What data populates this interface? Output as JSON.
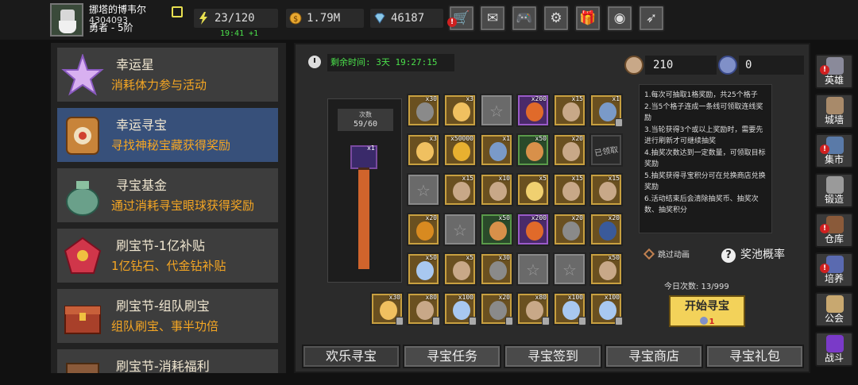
{
  "player": {
    "name": "挪塔的博韦尔",
    "id": "4304093",
    "rank": "勇者 - 5阶"
  },
  "resources": {
    "stamina": "23/120",
    "stamina_timer": "19:41 +1",
    "gold": "1.79M",
    "gems": "46187"
  },
  "top_buttons": [
    {
      "name": "shop",
      "icon": "cart-icon",
      "badge": "!"
    },
    {
      "name": "mail",
      "icon": "mail-icon"
    },
    {
      "name": "gamepad",
      "icon": "gamepad-icon"
    },
    {
      "name": "settings",
      "icon": "gear-icon"
    },
    {
      "name": "gift",
      "icon": "gift-icon"
    },
    {
      "name": "palette",
      "icon": "palette-icon"
    },
    {
      "name": "feather",
      "icon": "feather-icon"
    }
  ],
  "events": [
    {
      "title": "幸运星",
      "desc": "消耗体力参与活动",
      "icon_color": "#c89ae0"
    },
    {
      "title": "幸运寻宝",
      "desc": "寻找神秘宝藏获得奖励",
      "icon_color": "#c8843a"
    },
    {
      "title": "寻宝基金",
      "desc": "通过消耗寻宝眼球获得奖励",
      "icon_color": "#6aa08a"
    },
    {
      "title": "刷宝节-1亿补贴",
      "desc": "1亿钻石、代金钻补贴",
      "icon_color": "#d0364a"
    },
    {
      "title": "刷宝节-组队刷宝",
      "desc": "组队刷宝、事半功倍",
      "icon_color": "#a8402a"
    },
    {
      "title": "刷宝节-消耗福利",
      "desc": "",
      "icon_color": "#8a5a3a"
    }
  ],
  "main": {
    "remaining_time": "剩余时间: 3天 19:27:15",
    "currency1": "210",
    "currency2": "0",
    "progress_label": "次数",
    "progress_value": "59/60",
    "progress_fraction": 0.98,
    "progress_reward_count": "x1",
    "rules": [
      "1.每次可抽取1格奖励，共25个格子",
      "2.当5个格子连成一条线可领取连线奖励",
      "3.当轮获得3个或以上奖励时，需要先进行刷新才可继续抽奖",
      "4.抽奖次数达到一定数量，可领取目标奖励",
      "5.抽奖获得寻宝积分可在兑换商店兑换奖励",
      "6.活动结束后会清除抽奖币、抽奖次数、抽奖积分"
    ],
    "skip_animation": "跳过动画",
    "pool_rate": "奖池概率",
    "today_count": "今日次数: 13/999",
    "start_button": "开始寻宝",
    "start_cost": "1",
    "claimed_text": "已领取"
  },
  "grid": [
    [
      {
        "t": "t-gold",
        "c": "x30",
        "a": "#8a8a8a",
        "lock": false
      },
      {
        "t": "t-gold",
        "c": "x3",
        "a": "#f0c060",
        "lock": false
      },
      {
        "t": "t-empty",
        "c": "",
        "a": "",
        "lock": false,
        "star": true
      },
      {
        "t": "t-purple",
        "c": "x200",
        "a": "#e06a2a",
        "lock": false
      },
      {
        "t": "t-gold",
        "c": "x15",
        "a": "#c8a888",
        "lock": false
      },
      {
        "t": "t-gold",
        "c": "x1",
        "a": "#7a9ac8",
        "lock": true
      }
    ],
    [
      {
        "t": "t-gold",
        "c": "x3",
        "a": "#f0c060",
        "lock": false
      },
      {
        "t": "t-gold",
        "c": "x50000",
        "a": "#e8b030",
        "lock": false
      },
      {
        "t": "t-gold",
        "c": "x1",
        "a": "#7a9ac8",
        "lock": false
      },
      {
        "t": "t-green",
        "c": "x50",
        "a": "#d8904a",
        "lock": false
      },
      {
        "t": "t-gold",
        "c": "x20",
        "a": "#c8a888",
        "lock": false
      },
      {
        "t": "t-claimed",
        "c": "",
        "a": "",
        "lock": false,
        "claimed": true
      }
    ],
    [
      {
        "t": "t-empty",
        "c": "",
        "a": "",
        "lock": false,
        "star": true
      },
      {
        "t": "t-gold",
        "c": "x15",
        "a": "#c8a888",
        "lock": false
      },
      {
        "t": "t-gold",
        "c": "x10",
        "a": "#c8a888",
        "lock": false
      },
      {
        "t": "t-gold",
        "c": "x5",
        "a": "#f0d070",
        "lock": false
      },
      {
        "t": "t-gold",
        "c": "x15",
        "a": "#c8a888",
        "lock": false
      },
      {
        "t": "t-gold",
        "c": "x15",
        "a": "#c8a888",
        "lock": false
      }
    ],
    [
      {
        "t": "t-gold",
        "c": "x20",
        "a": "#d88a20",
        "lock": false
      },
      {
        "t": "t-empty",
        "c": "",
        "a": "",
        "lock": false,
        "star": true
      },
      {
        "t": "t-green",
        "c": "x50",
        "a": "#d8904a",
        "lock": false
      },
      {
        "t": "t-purple",
        "c": "x200",
        "a": "#e06a2a",
        "lock": false
      },
      {
        "t": "t-gold",
        "c": "x20",
        "a": "#8a8a8a",
        "lock": false
      },
      {
        "t": "t-gold",
        "c": "x20",
        "a": "#3a5a9a",
        "lock": false
      }
    ],
    [
      {
        "t": "t-gold",
        "c": "x50",
        "a": "#a8c8f0",
        "lock": false
      },
      {
        "t": "t-gold",
        "c": "x5",
        "a": "#c8a888",
        "lock": false
      },
      {
        "t": "t-gold",
        "c": "x30",
        "a": "#8a8a8a",
        "lock": false
      },
      {
        "t": "t-empty",
        "c": "",
        "a": "",
        "lock": false,
        "star": true
      },
      {
        "t": "t-empty",
        "c": "",
        "a": "",
        "lock": false,
        "star": true
      },
      {
        "t": "t-gold",
        "c": "x50",
        "a": "#c8a888",
        "lock": false
      }
    ],
    [
      {
        "t": "t-gold",
        "c": "x30",
        "a": "#f0c060",
        "lock": true
      },
      {
        "t": "t-gold",
        "c": "x80",
        "a": "#c8a888",
        "lock": true
      },
      {
        "t": "t-gold",
        "c": "x100",
        "a": "#a8c8f0",
        "lock": true
      },
      {
        "t": "t-gold",
        "c": "x20",
        "a": "#8a8a8a",
        "lock": true
      },
      {
        "t": "t-gold",
        "c": "x80",
        "a": "#c8a888",
        "lock": true
      },
      {
        "t": "t-gold",
        "c": "x100",
        "a": "#a8c8f0",
        "lock": true
      },
      {
        "t": "t-gold",
        "c": "x100",
        "a": "#a8c8f0",
        "lock": true
      }
    ]
  ],
  "tabs": [
    "欢乐寻宝",
    "寻宝任务",
    "寻宝签到",
    "寻宝商店",
    "寻宝礼包"
  ],
  "right_nav": [
    {
      "label": "英雄",
      "icon_color": "#8a8a9a",
      "badge": "!"
    },
    {
      "label": "城墙",
      "icon_color": "#a88a6a",
      "badge": ""
    },
    {
      "label": "集市",
      "icon_color": "#5a7aa8",
      "badge": "!"
    },
    {
      "label": "锻造",
      "icon_color": "#9a9a9a",
      "badge": ""
    },
    {
      "label": "仓库",
      "icon_color": "#8a5a3a",
      "badge": "!"
    },
    {
      "label": "培养",
      "icon_color": "#5a6ab0",
      "badge": "!"
    },
    {
      "label": "公会",
      "icon_color": "#c8a870",
      "badge": ""
    },
    {
      "label": "战斗",
      "icon_color": "#7a3ac8",
      "badge": ""
    }
  ]
}
